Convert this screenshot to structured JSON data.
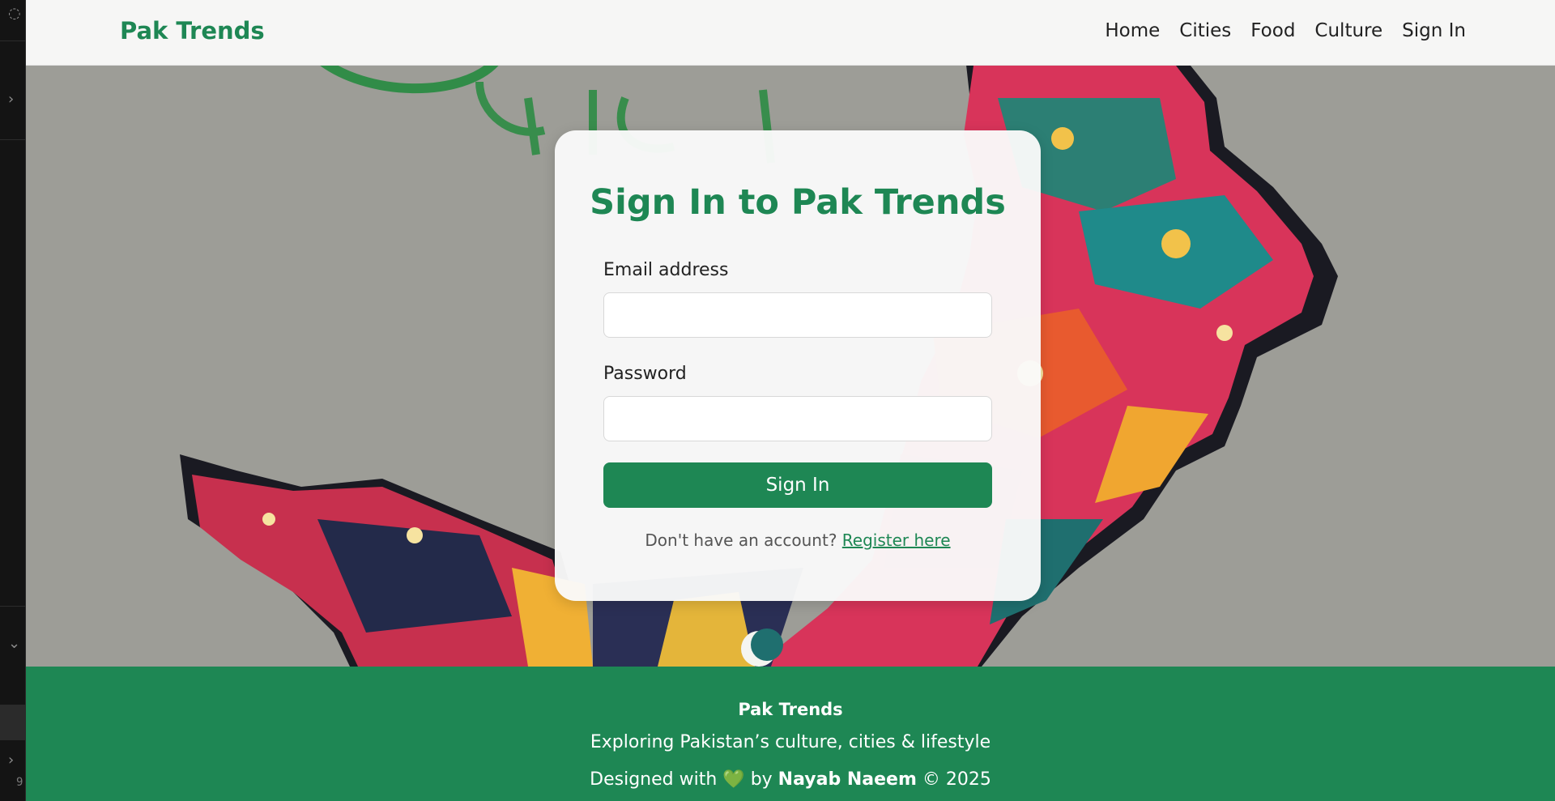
{
  "navbar": {
    "brand": "Pak Trends",
    "links": [
      "Home",
      "Cities",
      "Food",
      "Culture",
      "Sign In"
    ]
  },
  "signin": {
    "title": "Sign In to Pak Trends",
    "email_label": "Email address",
    "email_value": "",
    "password_label": "Password",
    "password_value": "",
    "button_label": "Sign In",
    "register_prompt": "Don't have an account?",
    "register_link": "Register here"
  },
  "footer": {
    "title": "Pak Trends",
    "tagline": "Exploring Pakistan’s culture, cities & lifestyle",
    "credit_prefix": "Designed with",
    "heart": "💚",
    "credit_by": "by",
    "author": "Nayab Naeem",
    "credit_suffix": "© 2025"
  },
  "side_strip": {
    "line_number": "9"
  },
  "colors": {
    "brand_green": "#1e8754",
    "navbar_bg": "#f6f6f5",
    "hero_bg": "#9d9d97"
  }
}
